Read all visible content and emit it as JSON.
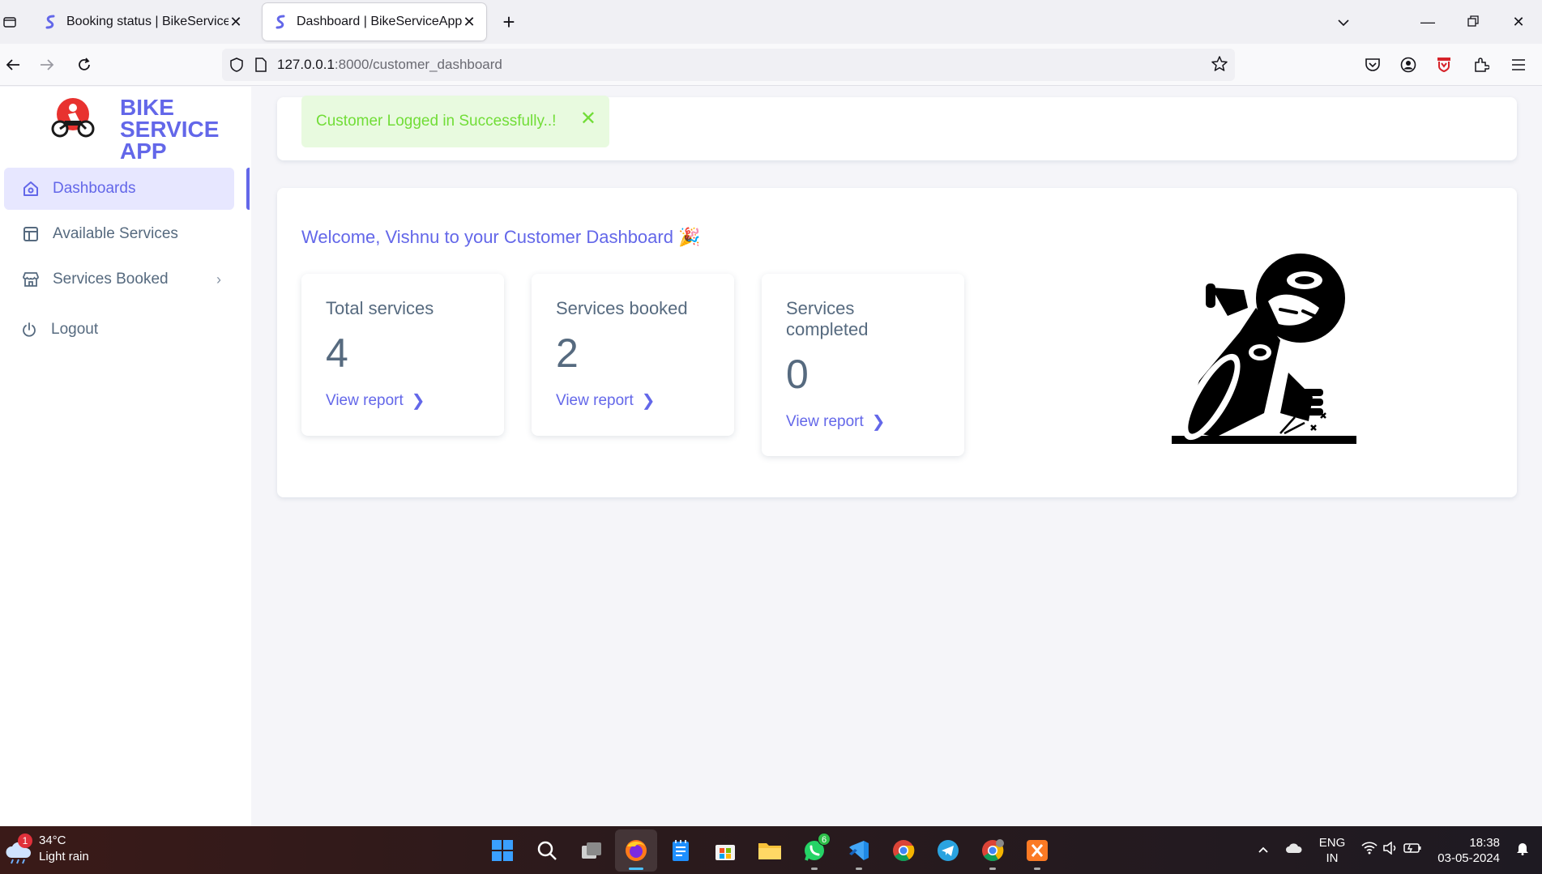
{
  "browser": {
    "tabs": [
      {
        "title": "Booking status | BikeServiceApp",
        "active": false
      },
      {
        "title": "Dashboard | BikeServiceApp",
        "active": true
      }
    ],
    "url_host": "127.0.0.1",
    "url_path": ":8000/customer_dashboard"
  },
  "sidebar": {
    "brand_lines": [
      "BIKE",
      "SERVICE",
      "APP"
    ],
    "items": [
      {
        "label": "Dashboards",
        "icon": "home-icon",
        "active": true
      },
      {
        "label": "Available Services",
        "icon": "layout-icon"
      },
      {
        "label": "Services Booked",
        "icon": "store-icon",
        "has_submenu": true
      },
      {
        "label": "Logout",
        "icon": "power-icon"
      }
    ]
  },
  "alert": {
    "message": "Customer Logged in Successfully..!",
    "close": "✕"
  },
  "dashboard": {
    "welcome": "Welcome, Vishnu to your Customer Dashboard 🎉",
    "stats": [
      {
        "title": "Total services",
        "value": "4",
        "link": "View report"
      },
      {
        "title": "Services booked",
        "value": "2",
        "link": "View report"
      },
      {
        "title": "Services completed",
        "value": "0",
        "link": "View report"
      }
    ]
  },
  "taskbar": {
    "weather_temp": "34°C",
    "weather_desc": "Light rain",
    "weather_badge": "1",
    "whatsapp_badge": "6",
    "lang_1": "ENG",
    "lang_2": "IN",
    "time": "18:38",
    "date": "03-05-2024"
  },
  "colors": {
    "primary": "#6367e9",
    "success": "#71dd37",
    "text": "#566a7f"
  }
}
